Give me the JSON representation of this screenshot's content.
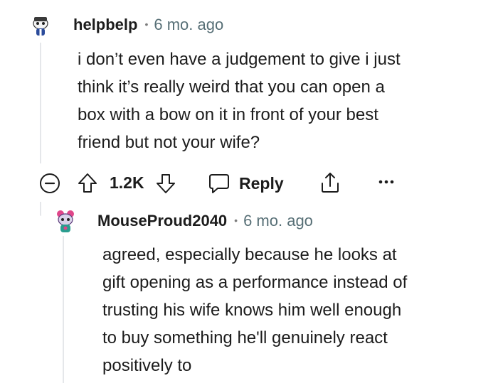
{
  "comment": {
    "username": "helpbelp",
    "separator": "•",
    "time": "6 mo. ago",
    "body_lines": [
      "i don’t even have a judgement to give i just",
      "think it’s really weird that you can open a",
      "box with a bow on it in front of your best",
      "friend but not your wife?"
    ],
    "actions": {
      "collapse_icon": "minus-circle-icon",
      "upvote_icon": "arrow-up-icon",
      "vote_count": "1.2K",
      "downvote_icon": "arrow-down-icon",
      "reply_icon": "speech-bubble-icon",
      "reply_label": "Reply",
      "share_icon": "share-icon",
      "more_icon": "ellipsis-icon"
    }
  },
  "reply": {
    "username": "MouseProud2040",
    "separator": "•",
    "time": "6 mo. ago",
    "body_lines": [
      "agreed, especially because he looks at",
      "gift opening as a performance instead of",
      "trusting his wife knows him well enough",
      "to buy something he'll genuinely react",
      "positively to"
    ]
  },
  "colors": {
    "text": "#1c1c1c",
    "meta": "#576f76",
    "thread_line": "#e5e7ea"
  }
}
